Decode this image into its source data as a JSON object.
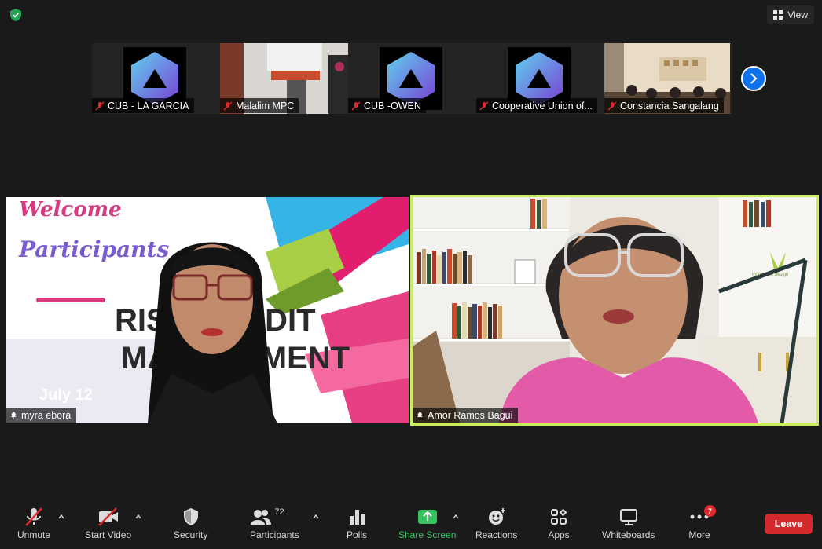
{
  "topbar": {
    "view_label": "View"
  },
  "thumbnails": [
    {
      "name": "CUB - LA GARCIA",
      "type": "logo"
    },
    {
      "name": "Malalim MPC",
      "type": "photo-office"
    },
    {
      "name": "CUB -OWEN",
      "type": "logo"
    },
    {
      "name": "Cooperative Union of...",
      "type": "logo"
    },
    {
      "name": "Constancia Sangalang",
      "type": "photo-room"
    }
  ],
  "main_tiles": [
    {
      "name": "myra ebora",
      "slide_text": {
        "line1": "Welcome",
        "line2": "Participants",
        "big1": "RISK CREDIT",
        "big2": "MANAGEMENT",
        "date": "July 12"
      }
    },
    {
      "name": "Amor Ramos Bagui",
      "brand": "innovative design"
    }
  ],
  "toolbar": {
    "unmute": "Unmute",
    "start_video": "Start Video",
    "security": "Security",
    "participants": "Participants",
    "participants_count": "72",
    "polls": "Polls",
    "share_screen": "Share Screen",
    "reactions": "Reactions",
    "apps": "Apps",
    "whiteboards": "Whiteboards",
    "more": "More",
    "more_badge": "7",
    "leave": "Leave"
  },
  "colors": {
    "accent_blue": "#0e72ed",
    "active_speaker": "#c9ee5b",
    "share_green": "#35c35e",
    "leave_red": "#d52a2d"
  }
}
